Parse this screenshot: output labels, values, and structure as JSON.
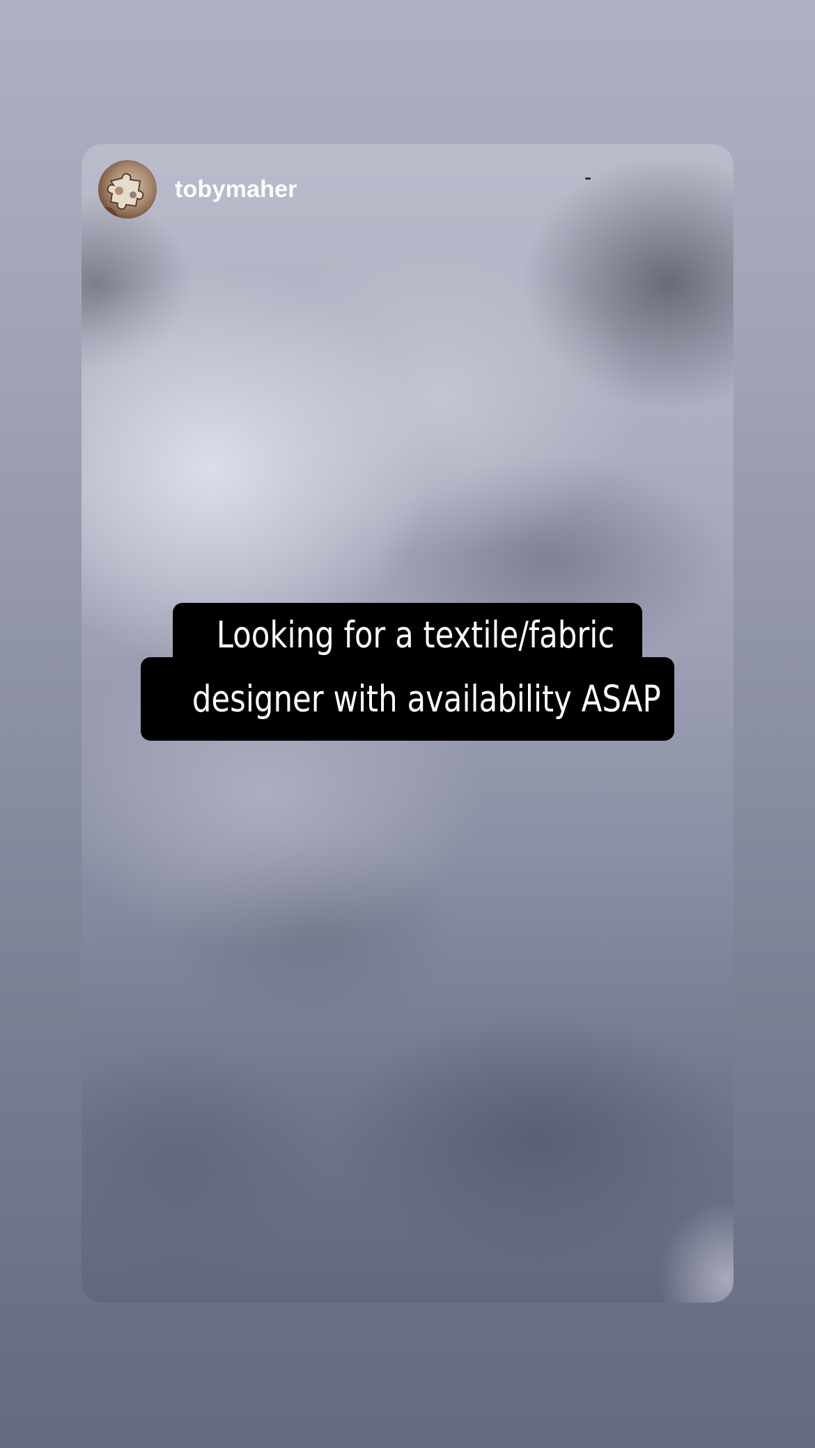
{
  "story": {
    "username": "tobymaher",
    "caption_lines": [
      "Looking for a textile/fabric",
      "designer with availability ASAP"
    ]
  },
  "colors": {
    "caption_background": "#000000",
    "caption_text": "#ffffff",
    "username_text": "#ffffff"
  },
  "icons": {
    "avatar": "profile-photo"
  }
}
